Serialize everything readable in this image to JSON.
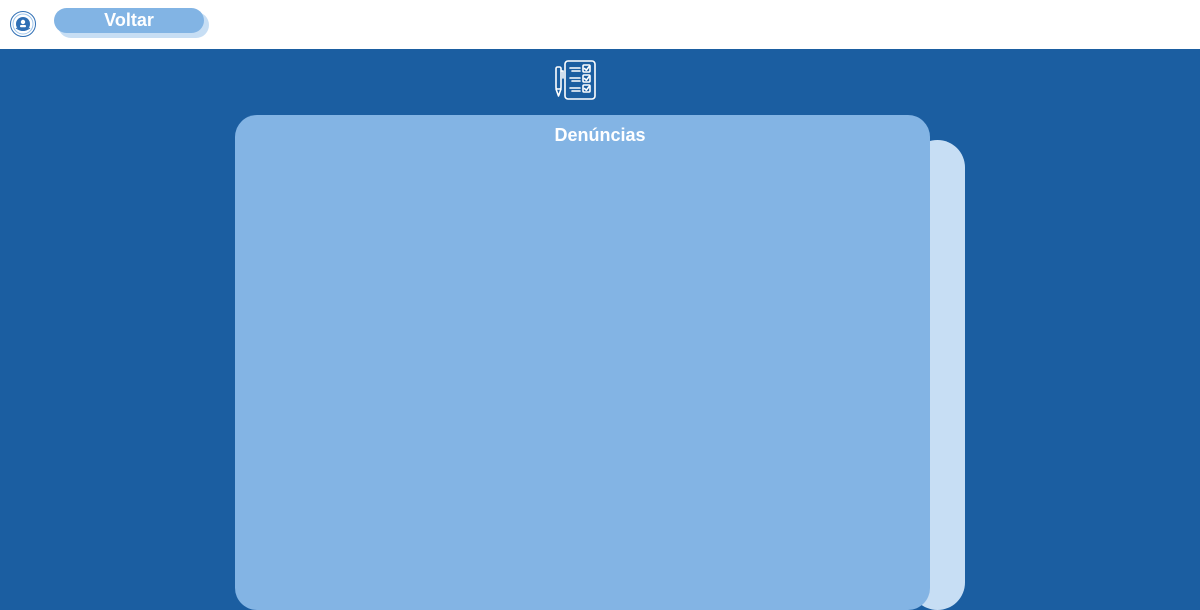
{
  "header": {
    "logo_icon": "institution-seal-icon",
    "back_label": "Voltar"
  },
  "main": {
    "icon": "checklist-with-pen-icon",
    "card_title": "Denúncias"
  },
  "colors": {
    "background": "#1b5ea1",
    "topbar": "#ffffff",
    "card": "#83b4e4",
    "card_back": "#c7def4",
    "button": "#82b4e4"
  }
}
